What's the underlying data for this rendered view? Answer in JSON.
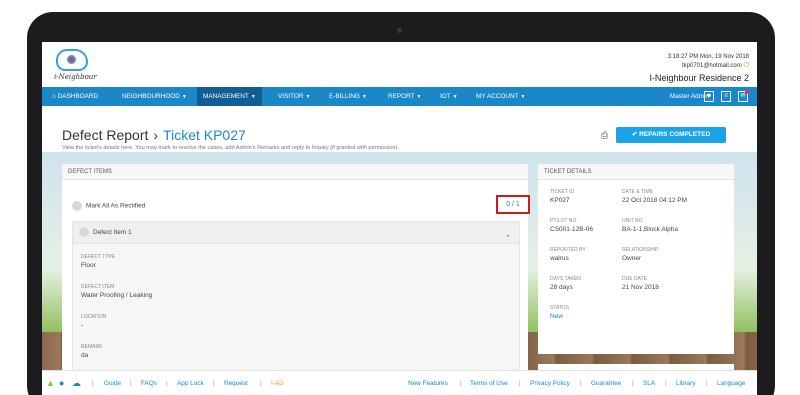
{
  "header": {
    "logo_text": "i-Neighbour",
    "clock": "3:18:27 PM Mon, 19 Nov 2018",
    "email": "tkp0701@hotmail.com",
    "site_name": "I-Neighbour Residence 2"
  },
  "nav": {
    "items": [
      {
        "label": "DASHBOARD",
        "icon": "home-icon"
      },
      {
        "label": "NEIGHBOURHOOD"
      },
      {
        "label": "MANAGEMENT"
      },
      {
        "label": "VISITOR"
      },
      {
        "label": "E-BILLING"
      },
      {
        "label": "REPORT"
      },
      {
        "label": "IOT"
      },
      {
        "label": "MY ACCOUNT"
      }
    ],
    "user": "Master Admin",
    "active_color": "#0f5f94",
    "bar_color": "#1a87c9"
  },
  "page": {
    "title": "Defect Report",
    "ticket_title": "Ticket KP027",
    "description": "View the ticket's details here. You may mark to resolve the cases, add Admin's Remarks and reply to Inquiry (if granted with permission).",
    "repairs_button": "REPAIRS COMPLETED"
  },
  "defect_items": {
    "heading": "DEFECT ITEMS",
    "mark_all": "Mark All As Rectified",
    "counter": "0 / 1",
    "item": {
      "title": "Defect Item 1",
      "fields": [
        {
          "label": "DEFECT TYPE",
          "value": "Floor"
        },
        {
          "label": "DEFECT ITEM",
          "value": "Water Proofing / Leaking"
        },
        {
          "label": "LOCATION",
          "value": "-"
        },
        {
          "label": "REMARK",
          "value": "da"
        }
      ]
    }
  },
  "ticket_details": {
    "heading": "TICKET DETAILS",
    "fields": [
      {
        "label": "TICKET ID",
        "value": "KP027"
      },
      {
        "label": "DATE & TIME",
        "value": "22 Oct 2018 04:12 PM"
      },
      {
        "label": "PT/LOT NO.",
        "value": "CS001-12B-06"
      },
      {
        "label": "UNIT NO.",
        "value": "BA-1-1,Block Alpha"
      },
      {
        "label": "REPORTED BY",
        "value": "walrus"
      },
      {
        "label": "RELATIONSHIP",
        "value": "Owner"
      },
      {
        "label": "DAYS TAKEN",
        "value": "28 days"
      },
      {
        "label": "DUE DATE",
        "value": "21 Nov 2018"
      },
      {
        "label": "STATUS",
        "value": "New"
      }
    ]
  },
  "footer": {
    "left_links": [
      "Guide",
      "FAQs",
      "App Lock",
      "Request",
      "I-AD"
    ],
    "right_links": [
      "New Features",
      "Terms of Use",
      "Privacy Policy",
      "Guarantee",
      "SLA",
      "Library",
      "Language"
    ]
  }
}
